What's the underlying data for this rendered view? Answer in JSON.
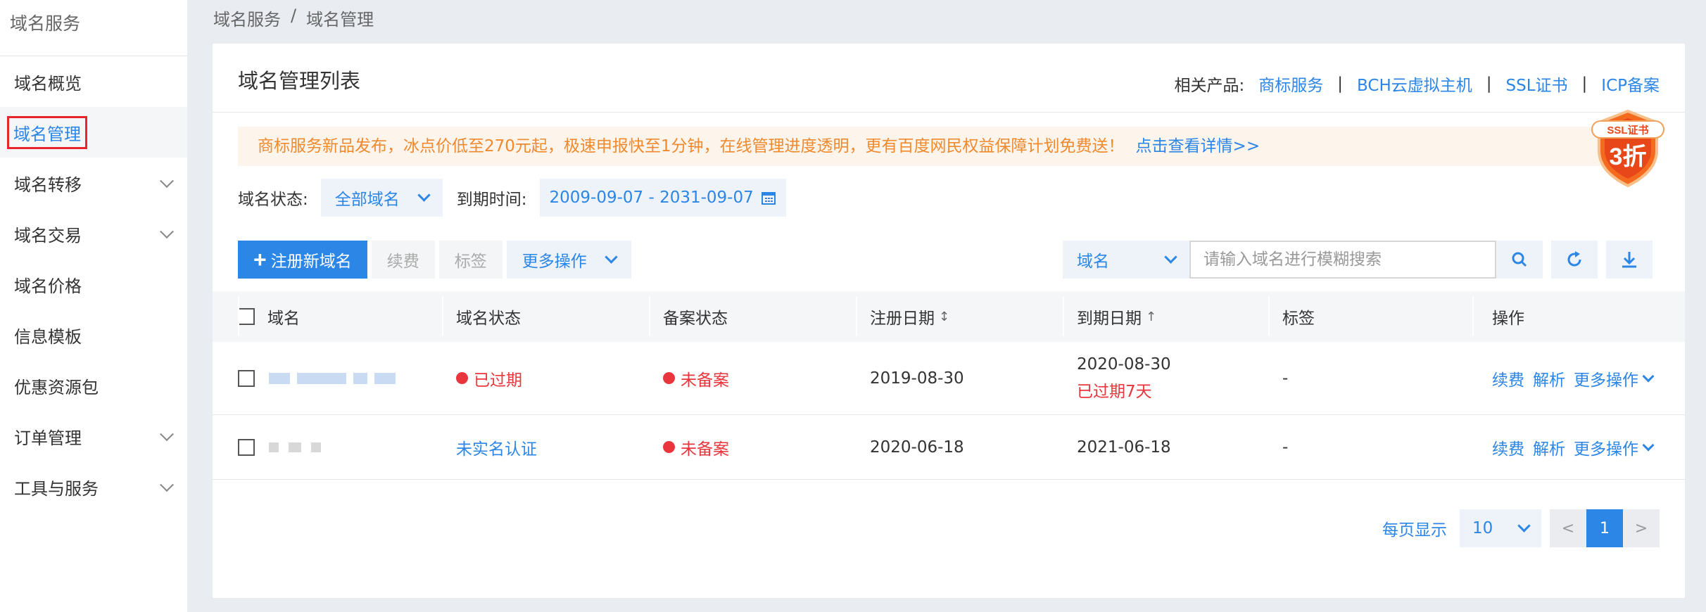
{
  "sidebar": {
    "title": "域名服务",
    "items": [
      {
        "label": "域名概览"
      },
      {
        "label": "域名管理"
      },
      {
        "label": "域名转移"
      },
      {
        "label": "域名交易"
      },
      {
        "label": "域名价格"
      },
      {
        "label": "信息模板"
      },
      {
        "label": "优惠资源包"
      },
      {
        "label": "订单管理"
      },
      {
        "label": "工具与服务"
      }
    ]
  },
  "breadcrumb": {
    "root": "域名服务",
    "separator": "/",
    "current": "域名管理"
  },
  "card": {
    "title": "域名管理列表"
  },
  "related": {
    "label": "相关产品:",
    "links": [
      "商标服务",
      "BCH云虚拟主机",
      "SSL证书",
      "ICP备案"
    ],
    "separator": "|"
  },
  "notice": {
    "text": "商标服务新品发布，冰点价低至270元起，极速申报快至1分钟，在线管理进度透明，更有百度网民权益保障计划免费送！",
    "link": "点击查看详情>>"
  },
  "badge": {
    "top": "SSL证书",
    "main": "3折"
  },
  "filters": {
    "status_label": "域名状态:",
    "status_value": "全部域名",
    "expiry_label": "到期时间:",
    "date_range": "2009-09-07 - 2031-09-07"
  },
  "toolbar": {
    "register": "注册新域名",
    "renew": "续费",
    "tag": "标签",
    "more": "更多操作"
  },
  "search": {
    "field": "域名",
    "placeholder": "请输入域名进行模糊搜索"
  },
  "table": {
    "headers": {
      "domain": "域名",
      "status": "域名状态",
      "icp": "备案状态",
      "reg_date": "注册日期",
      "exp_date": "到期日期",
      "tag": "标签",
      "action": "操作"
    },
    "sort_icons": {
      "reg_date": "↕",
      "exp_date": "↑"
    },
    "rows": [
      {
        "status": "已过期",
        "icp": "未备案",
        "reg_date": "2019-08-30",
        "exp_date": "2020-08-30",
        "exp_note": "已过期7天",
        "tag": "-",
        "actions": {
          "renew": "续费",
          "resolve": "解析",
          "more": "更多操作"
        }
      },
      {
        "status": "未实名认证",
        "icp": "未备案",
        "reg_date": "2020-06-18",
        "exp_date": "2021-06-18",
        "tag": "-",
        "actions": {
          "renew": "续费",
          "resolve": "解析",
          "more": "更多操作"
        }
      }
    ]
  },
  "pagination": {
    "label": "每页显示",
    "page_size": "10",
    "prev": "<",
    "current": "1",
    "next": ">"
  },
  "colors": {
    "accent": "#2b86e6",
    "danger": "#e8363c",
    "notice_text": "#ef8a2e",
    "notice_bg": "#fdf4ec"
  }
}
